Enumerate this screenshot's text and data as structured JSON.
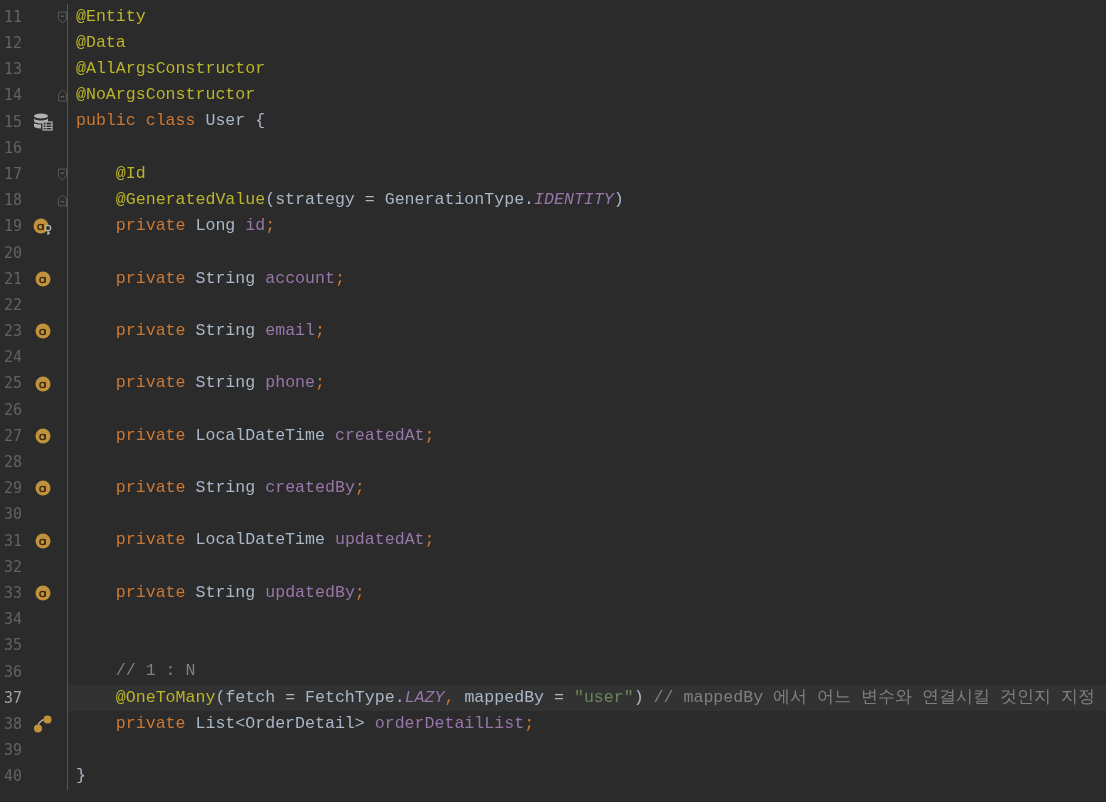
{
  "editor": {
    "lines": [
      {
        "number": "11",
        "current": false,
        "fold": {
          "kind": "start"
        },
        "tokens": [
          {
            "kind": "annotation",
            "text": "@Entity"
          }
        ]
      },
      {
        "number": "12",
        "current": false,
        "tokens": [
          {
            "kind": "annotation",
            "text": "@Data"
          }
        ]
      },
      {
        "number": "13",
        "current": false,
        "tokens": [
          {
            "kind": "annotation",
            "text": "@AllArgsConstructor"
          }
        ]
      },
      {
        "number": "14",
        "current": false,
        "fold": {
          "kind": "end"
        },
        "tokens": [
          {
            "kind": "annotation",
            "text": "@NoArgsConstructor"
          }
        ]
      },
      {
        "number": "15",
        "current": false,
        "gutter": {
          "kind": "entity"
        },
        "tokens": [
          {
            "kind": "keyword",
            "text": "public class "
          },
          {
            "kind": "plain",
            "text": "User {"
          }
        ]
      },
      {
        "number": "16",
        "current": false
      },
      {
        "number": "17",
        "current": false,
        "fold": {
          "kind": "start"
        },
        "tokens": [
          {
            "kind": "annotation",
            "text": "    @Id"
          }
        ]
      },
      {
        "number": "18",
        "current": false,
        "fold": {
          "kind": "end"
        },
        "tokens": [
          {
            "kind": "annotation",
            "text": "    @GeneratedValue"
          },
          {
            "kind": "plain",
            "text": "(strategy = GenerationType."
          },
          {
            "kind": "constant",
            "text": "IDENTITY"
          },
          {
            "kind": "plain",
            "text": ")"
          }
        ]
      },
      {
        "number": "19",
        "current": false,
        "gutter": {
          "kind": "id_field"
        },
        "tokens": [
          {
            "kind": "keyword",
            "text": "    private "
          },
          {
            "kind": "plain",
            "text": "Long "
          },
          {
            "kind": "field",
            "text": "id"
          },
          {
            "kind": "keyword",
            "text": ";"
          }
        ]
      },
      {
        "number": "20",
        "current": false
      },
      {
        "number": "21",
        "current": false,
        "gutter": {
          "kind": "field"
        },
        "tokens": [
          {
            "kind": "keyword",
            "text": "    private "
          },
          {
            "kind": "plain",
            "text": "String "
          },
          {
            "kind": "field",
            "text": "account"
          },
          {
            "kind": "keyword",
            "text": ";"
          }
        ]
      },
      {
        "number": "22",
        "current": false
      },
      {
        "number": "23",
        "current": false,
        "gutter": {
          "kind": "field"
        },
        "tokens": [
          {
            "kind": "keyword",
            "text": "    private "
          },
          {
            "kind": "plain",
            "text": "String "
          },
          {
            "kind": "field",
            "text": "email"
          },
          {
            "kind": "keyword",
            "text": ";"
          }
        ]
      },
      {
        "number": "24",
        "current": false
      },
      {
        "number": "25",
        "current": false,
        "gutter": {
          "kind": "field"
        },
        "tokens": [
          {
            "kind": "keyword",
            "text": "    private "
          },
          {
            "kind": "plain",
            "text": "String "
          },
          {
            "kind": "field",
            "text": "phone"
          },
          {
            "kind": "keyword",
            "text": ";"
          }
        ]
      },
      {
        "number": "26",
        "current": false
      },
      {
        "number": "27",
        "current": false,
        "gutter": {
          "kind": "field"
        },
        "tokens": [
          {
            "kind": "keyword",
            "text": "    private "
          },
          {
            "kind": "plain",
            "text": "LocalDateTime "
          },
          {
            "kind": "field",
            "text": "createdAt"
          },
          {
            "kind": "keyword",
            "text": ";"
          }
        ]
      },
      {
        "number": "28",
        "current": false
      },
      {
        "number": "29",
        "current": false,
        "gutter": {
          "kind": "field"
        },
        "tokens": [
          {
            "kind": "keyword",
            "text": "    private "
          },
          {
            "kind": "plain",
            "text": "String "
          },
          {
            "kind": "field",
            "text": "createdBy"
          },
          {
            "kind": "keyword",
            "text": ";"
          }
        ]
      },
      {
        "number": "30",
        "current": false
      },
      {
        "number": "31",
        "current": false,
        "gutter": {
          "kind": "field"
        },
        "tokens": [
          {
            "kind": "keyword",
            "text": "    private "
          },
          {
            "kind": "plain",
            "text": "LocalDateTime "
          },
          {
            "kind": "field",
            "text": "updatedAt"
          },
          {
            "kind": "keyword",
            "text": ";"
          }
        ]
      },
      {
        "number": "32",
        "current": false
      },
      {
        "number": "33",
        "current": false,
        "gutter": {
          "kind": "field"
        },
        "tokens": [
          {
            "kind": "keyword",
            "text": "    private "
          },
          {
            "kind": "plain",
            "text": "String "
          },
          {
            "kind": "field",
            "text": "updatedBy"
          },
          {
            "kind": "keyword",
            "text": ";"
          }
        ]
      },
      {
        "number": "34",
        "current": false
      },
      {
        "number": "35",
        "current": false
      },
      {
        "number": "36",
        "current": false,
        "tokens": [
          {
            "kind": "comment",
            "text": "    // 1 : N"
          }
        ]
      },
      {
        "number": "37",
        "current": true,
        "tokens": [
          {
            "kind": "annotation",
            "text": "    @OneToMany"
          },
          {
            "kind": "plain",
            "text": "(fetch = FetchType."
          },
          {
            "kind": "constant",
            "text": "LAZY"
          },
          {
            "kind": "keyword",
            "text": ", "
          },
          {
            "kind": "plain",
            "text": "mappedBy = "
          },
          {
            "kind": "string",
            "text": "\"user\""
          },
          {
            "kind": "plain",
            "text": ") "
          },
          {
            "kind": "comment",
            "text": "// mappedBy 에서 어느 변수와 연결시킬 것인지 지정"
          }
        ]
      },
      {
        "number": "38",
        "current": false,
        "gutter": {
          "kind": "relation"
        },
        "tokens": [
          {
            "kind": "keyword",
            "text": "    private "
          },
          {
            "kind": "plain",
            "text": "List<OrderDetail> "
          },
          {
            "kind": "field",
            "text": "orderDetailList"
          },
          {
            "kind": "keyword",
            "text": ";"
          }
        ]
      },
      {
        "number": "39",
        "current": false
      },
      {
        "number": "40",
        "current": false,
        "tokens": [
          {
            "kind": "plain",
            "text": "}"
          }
        ]
      }
    ]
  }
}
